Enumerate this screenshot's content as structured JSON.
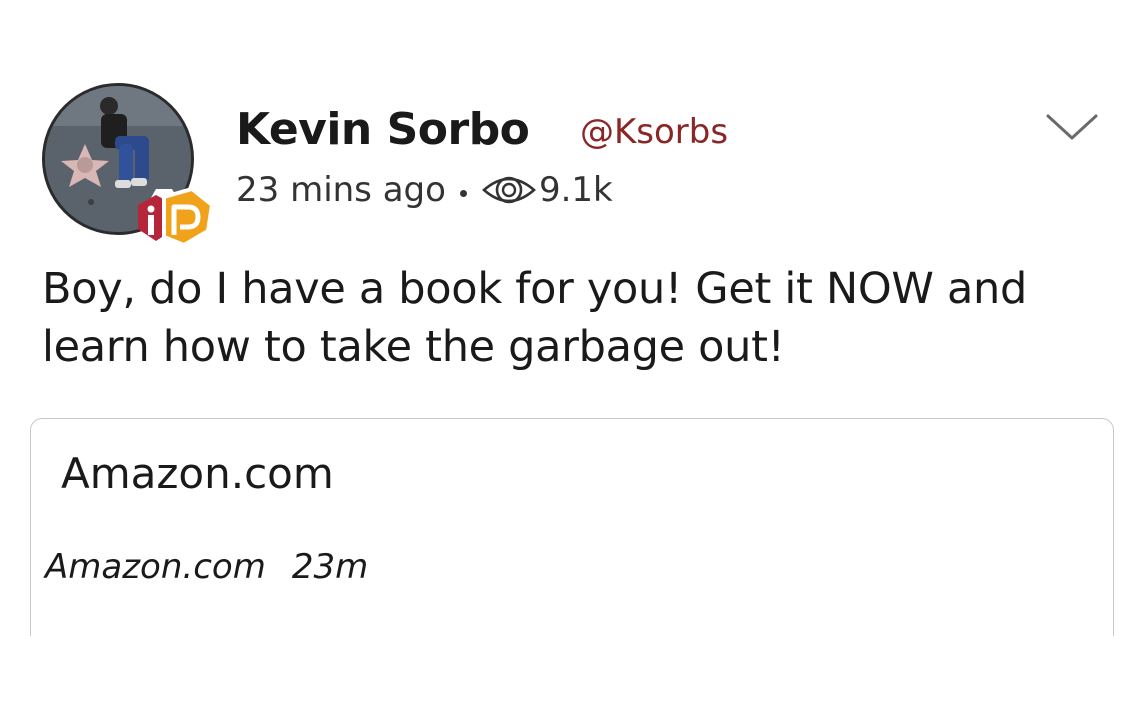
{
  "post": {
    "author_name": "Kevin Sorbo",
    "author_handle": "@Ksorbs",
    "time_ago": "23 mins ago",
    "views": "9.1k",
    "text": "Boy, do I have a book for you! Get it NOW and learn how to take the garbage out!",
    "link_card": {
      "title": "Amazon.com",
      "domain": "Amazon.com",
      "age": "23m"
    }
  },
  "colors": {
    "handle": "#8a2626",
    "badge_orange": "#f0a31a",
    "badge_red": "#b5263a",
    "border": "#c8c8c8"
  },
  "icons": {
    "menu": "chevron-down-icon",
    "views": "eye-icon",
    "badge": "parler-badge-icon"
  }
}
